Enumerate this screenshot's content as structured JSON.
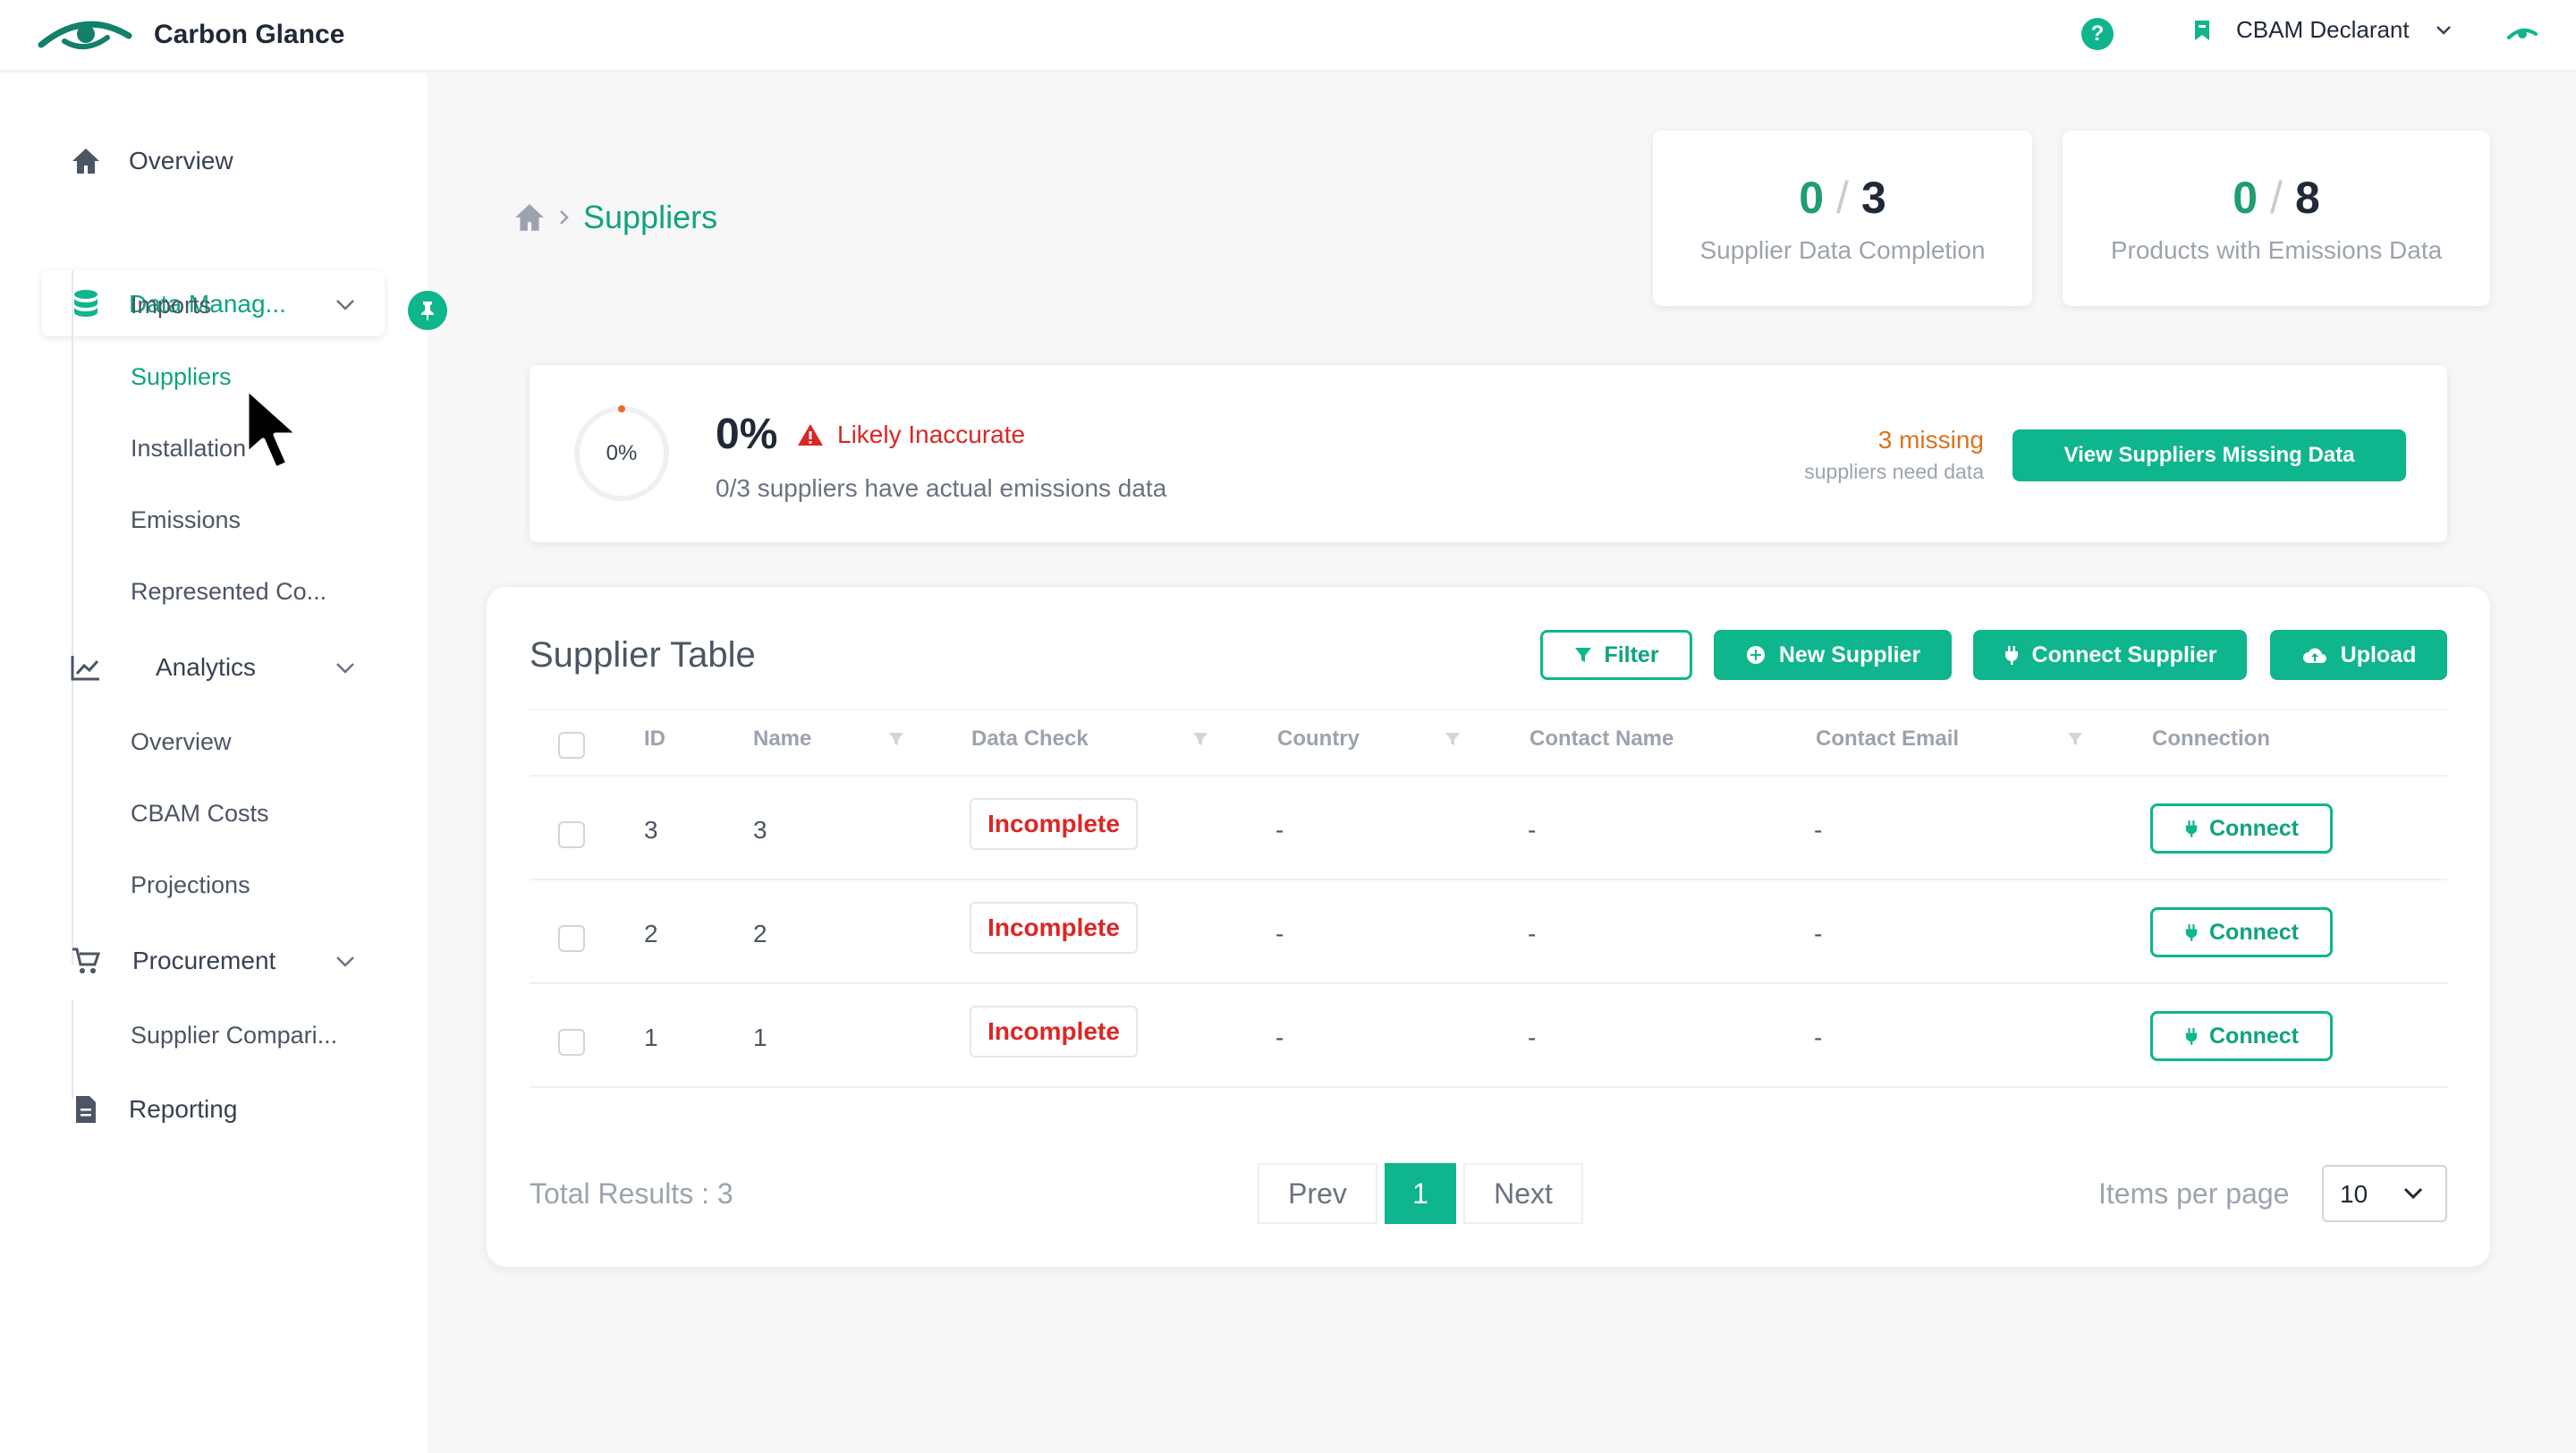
{
  "app": {
    "name": "Carbon Glance"
  },
  "topbar": {
    "help_label": "?",
    "role": "CBAM Declarant"
  },
  "sidebar": {
    "overview": "Overview",
    "data_management": "Data Manag...",
    "data_management_items": [
      "Imports",
      "Suppliers",
      "Installation",
      "Emissions",
      "Represented Co..."
    ],
    "analytics": "Analytics",
    "analytics_items": [
      "Overview",
      "CBAM Costs",
      "Projections"
    ],
    "procurement": "Procurement",
    "procurement_items": [
      "Supplier Compari..."
    ],
    "reporting": "Reporting",
    "active_item": "Suppliers"
  },
  "page": {
    "title": "Suppliers"
  },
  "stats": [
    {
      "value": "0",
      "total": "3",
      "label": "Supplier Data Completion"
    },
    {
      "value": "0",
      "total": "8",
      "label": "Products with Emissions Data"
    }
  ],
  "banner": {
    "ring_label": "0%",
    "percent": "0%",
    "warning": "Likely Inaccurate",
    "subtitle": "0/3 suppliers have actual emissions data",
    "missing": "3 missing",
    "missing_sub": "suppliers need data",
    "button": "View Suppliers Missing Data"
  },
  "table": {
    "title": "Supplier Table",
    "actions": {
      "filter": "Filter",
      "new_supplier": "New Supplier",
      "connect_supplier": "Connect Supplier",
      "upload": "Upload"
    },
    "columns": [
      "ID",
      "Name",
      "Data Check",
      "Country",
      "Contact Name",
      "Contact Email",
      "Connection"
    ],
    "rows": [
      {
        "id": "3",
        "name": "3",
        "data_check": "Incomplete",
        "country": "-",
        "contact_name": "-",
        "contact_email": "-",
        "connection": "Connect"
      },
      {
        "id": "2",
        "name": "2",
        "data_check": "Incomplete",
        "country": "-",
        "contact_name": "-",
        "contact_email": "-",
        "connection": "Connect"
      },
      {
        "id": "1",
        "name": "1",
        "data_check": "Incomplete",
        "country": "-",
        "contact_name": "-",
        "contact_email": "-",
        "connection": "Connect"
      }
    ],
    "footer": {
      "total": "Total Results : 3",
      "prev": "Prev",
      "page": "1",
      "next": "Next",
      "items_per_page_label": "Items per page",
      "items_per_page": "10"
    }
  },
  "colors": {
    "accent": "#0fb58c",
    "danger": "#dc2626",
    "warning": "#d9731e"
  }
}
